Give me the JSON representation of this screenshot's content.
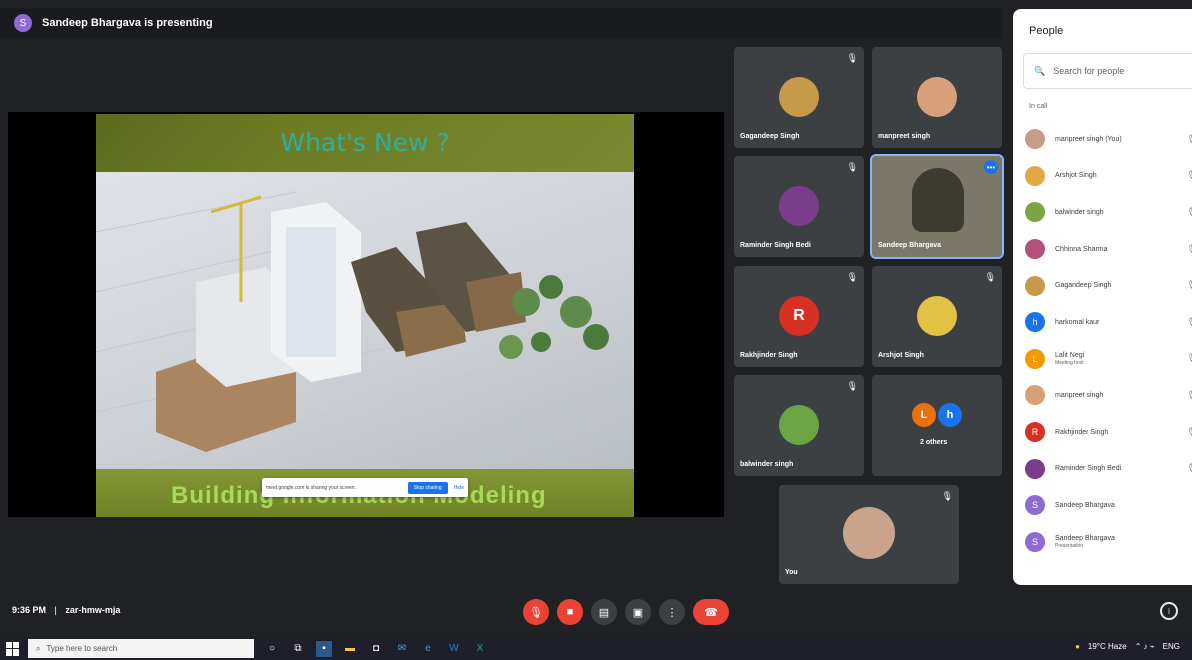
{
  "presenting_banner": {
    "avatar_letter": "S",
    "text": "Sandeep Bhargava is presenting"
  },
  "slide": {
    "title": "What's New ?",
    "footer": "Building Information Modeling",
    "notice": {
      "text": "meet.google.com is sharing your screen.",
      "stop_label": "Stop sharing",
      "hide_label": "Hide"
    }
  },
  "tiles": [
    {
      "name": "Gagandeep Singh",
      "avatar": "photo",
      "color": "#c79a4a"
    },
    {
      "name": "manpreet singh",
      "avatar": "photo",
      "color": "#d8a07a"
    },
    {
      "name": "Raminder Singh Bedi",
      "avatar": "photo",
      "color": "#7a3d8c"
    },
    {
      "name": "Sandeep Bhargava",
      "avatar": "video",
      "color": "#6b6b5a"
    },
    {
      "name": "Rakhjinder Singh",
      "avatar": "R",
      "color": "#d93025"
    },
    {
      "name": "Arshjot Singh",
      "avatar": "photo",
      "color": "#e2c244"
    },
    {
      "name": "balwinder singh",
      "avatar": "photo",
      "color": "#6aa544"
    },
    {
      "name": "2 others",
      "avatar": "group",
      "color": "#e8710a"
    },
    {
      "name": "You",
      "avatar": "photo",
      "color": "#caa38d"
    }
  ],
  "bottom": {
    "time": "9:36 PM",
    "separator": "|",
    "meeting_code": "zar-hmw-mja"
  },
  "people_panel": {
    "title": "People",
    "search_placeholder": "Search for people",
    "section_label": "In call",
    "participants": [
      {
        "name": "manpreet singh (You)",
        "sub": "",
        "avatar": "",
        "color": "#c79a8a"
      },
      {
        "name": "Arshjot Singh",
        "sub": "",
        "avatar": "",
        "color": "#e2a844"
      },
      {
        "name": "balwinder singh",
        "sub": "",
        "avatar": "",
        "color": "#7ba544"
      },
      {
        "name": "Chhinna Sharma",
        "sub": "",
        "avatar": "",
        "color": "#b5507a"
      },
      {
        "name": "Gagandeep Singh",
        "sub": "",
        "avatar": "",
        "color": "#c79a4a"
      },
      {
        "name": "harkomal kaur",
        "sub": "",
        "avatar": "h",
        "color": "#1a73e8"
      },
      {
        "name": "Lalit Negi",
        "sub": "Meeting host",
        "avatar": "L",
        "color": "#f29900"
      },
      {
        "name": "manpreet singh",
        "sub": "",
        "avatar": "",
        "color": "#d8a07a"
      },
      {
        "name": "Rakhjinder Singh",
        "sub": "",
        "avatar": "R",
        "color": "#d93025"
      },
      {
        "name": "Raminder Singh Bedi",
        "sub": "",
        "avatar": "",
        "color": "#7a3d8c"
      },
      {
        "name": "Sandeep Bhargava",
        "sub": "",
        "avatar": "S",
        "color": "#8e6bd3"
      },
      {
        "name": "Sandeep Bhargava",
        "sub": "Presentation",
        "avatar": "S",
        "color": "#8e6bd3"
      }
    ]
  },
  "taskbar": {
    "search_placeholder": "Type here to search",
    "weather": "19°C Haze",
    "lang": "ENG"
  }
}
